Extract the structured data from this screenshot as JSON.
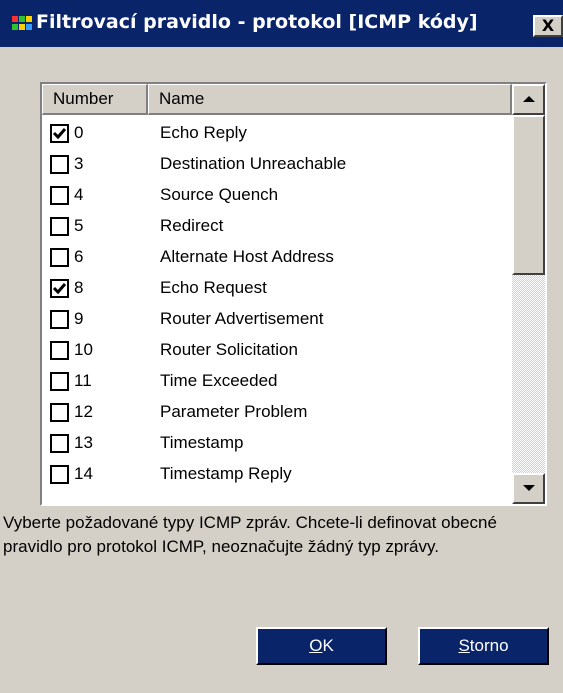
{
  "window": {
    "title": "Filtrovací pravidlo - protokol [ICMP kódy]",
    "close_label": "X",
    "icon": "app-icon"
  },
  "list": {
    "columns": [
      "Number",
      "Name"
    ],
    "rows": [
      {
        "number": "0",
        "name": "Echo Reply",
        "checked": true
      },
      {
        "number": "3",
        "name": "Destination Unreachable",
        "checked": false
      },
      {
        "number": "4",
        "name": "Source Quench",
        "checked": false
      },
      {
        "number": "5",
        "name": "Redirect",
        "checked": false
      },
      {
        "number": "6",
        "name": "Alternate Host Address",
        "checked": false
      },
      {
        "number": "8",
        "name": "Echo Request",
        "checked": true
      },
      {
        "number": "9",
        "name": "Router Advertisement",
        "checked": false
      },
      {
        "number": "10",
        "name": "Router Solicitation",
        "checked": false
      },
      {
        "number": "11",
        "name": "Time Exceeded",
        "checked": false
      },
      {
        "number": "12",
        "name": "Parameter Problem",
        "checked": false
      },
      {
        "number": "13",
        "name": "Timestamp",
        "checked": false
      },
      {
        "number": "14",
        "name": "Timestamp Reply",
        "checked": false
      }
    ]
  },
  "description": "Vyberte požadované typy ICMP zpráv. Chcete-li definovat obecné pravidlo pro protokol ICMP, neoznačujte žádný typ zprávy.",
  "buttons": {
    "ok": {
      "accel": "O",
      "rest": "K"
    },
    "cancel": {
      "accel": "S",
      "rest": "torno"
    }
  },
  "colors": {
    "titlebar": "#0a246a",
    "face": "#d4d0c8",
    "button_fill": "#0a246a"
  }
}
